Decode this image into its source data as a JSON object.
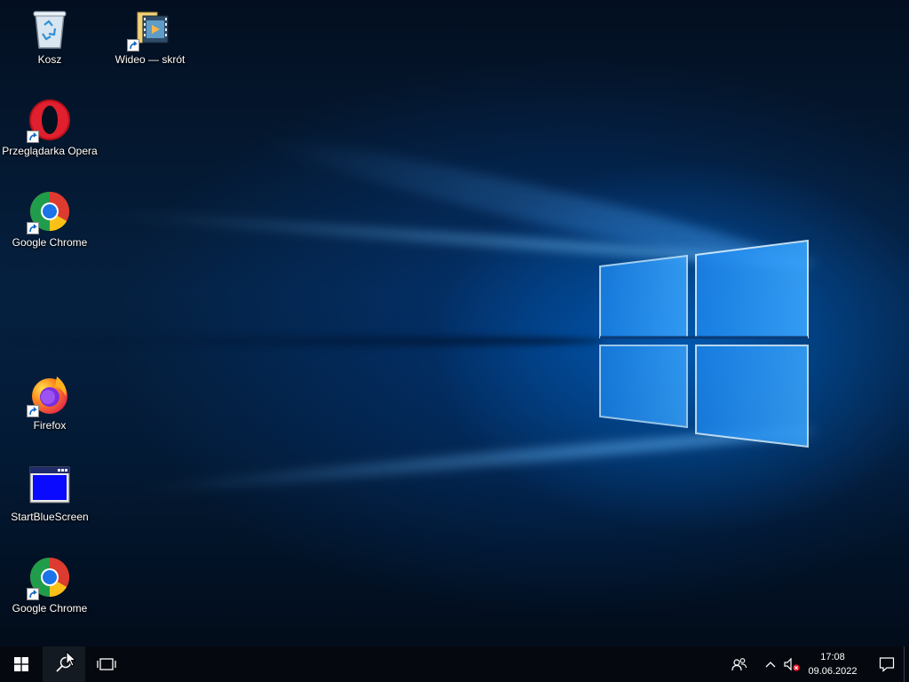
{
  "desktop": {
    "icons": [
      {
        "label": "Kosz",
        "icon": "recycle-bin-icon"
      },
      {
        "label": "Wideo — skrót",
        "icon": "video-folder-icon"
      },
      {
        "label": "Przeglądarka Opera",
        "icon": "opera-icon"
      },
      {
        "label": "Google Chrome",
        "icon": "chrome-icon"
      },
      {
        "label": "Firefox",
        "icon": "firefox-icon"
      },
      {
        "label": "StartBlueScreen",
        "icon": "bluescreen-app-icon"
      },
      {
        "label": "Google Chrome",
        "icon": "chrome-icon"
      }
    ]
  },
  "taskbar": {
    "start": "windows-logo-icon",
    "search": "search-icon",
    "task_view": "task-view-icon",
    "tray": {
      "people": "people-icon",
      "show_hidden": "chevron-up-icon",
      "volume": "volume-muted-icon",
      "notifications": "action-center-icon"
    },
    "clock": {
      "time": "17:08",
      "date": "09.06.2022"
    }
  },
  "colors": {
    "taskbar_bg": "#05090f",
    "wallpaper_accent": "#0078d7"
  }
}
